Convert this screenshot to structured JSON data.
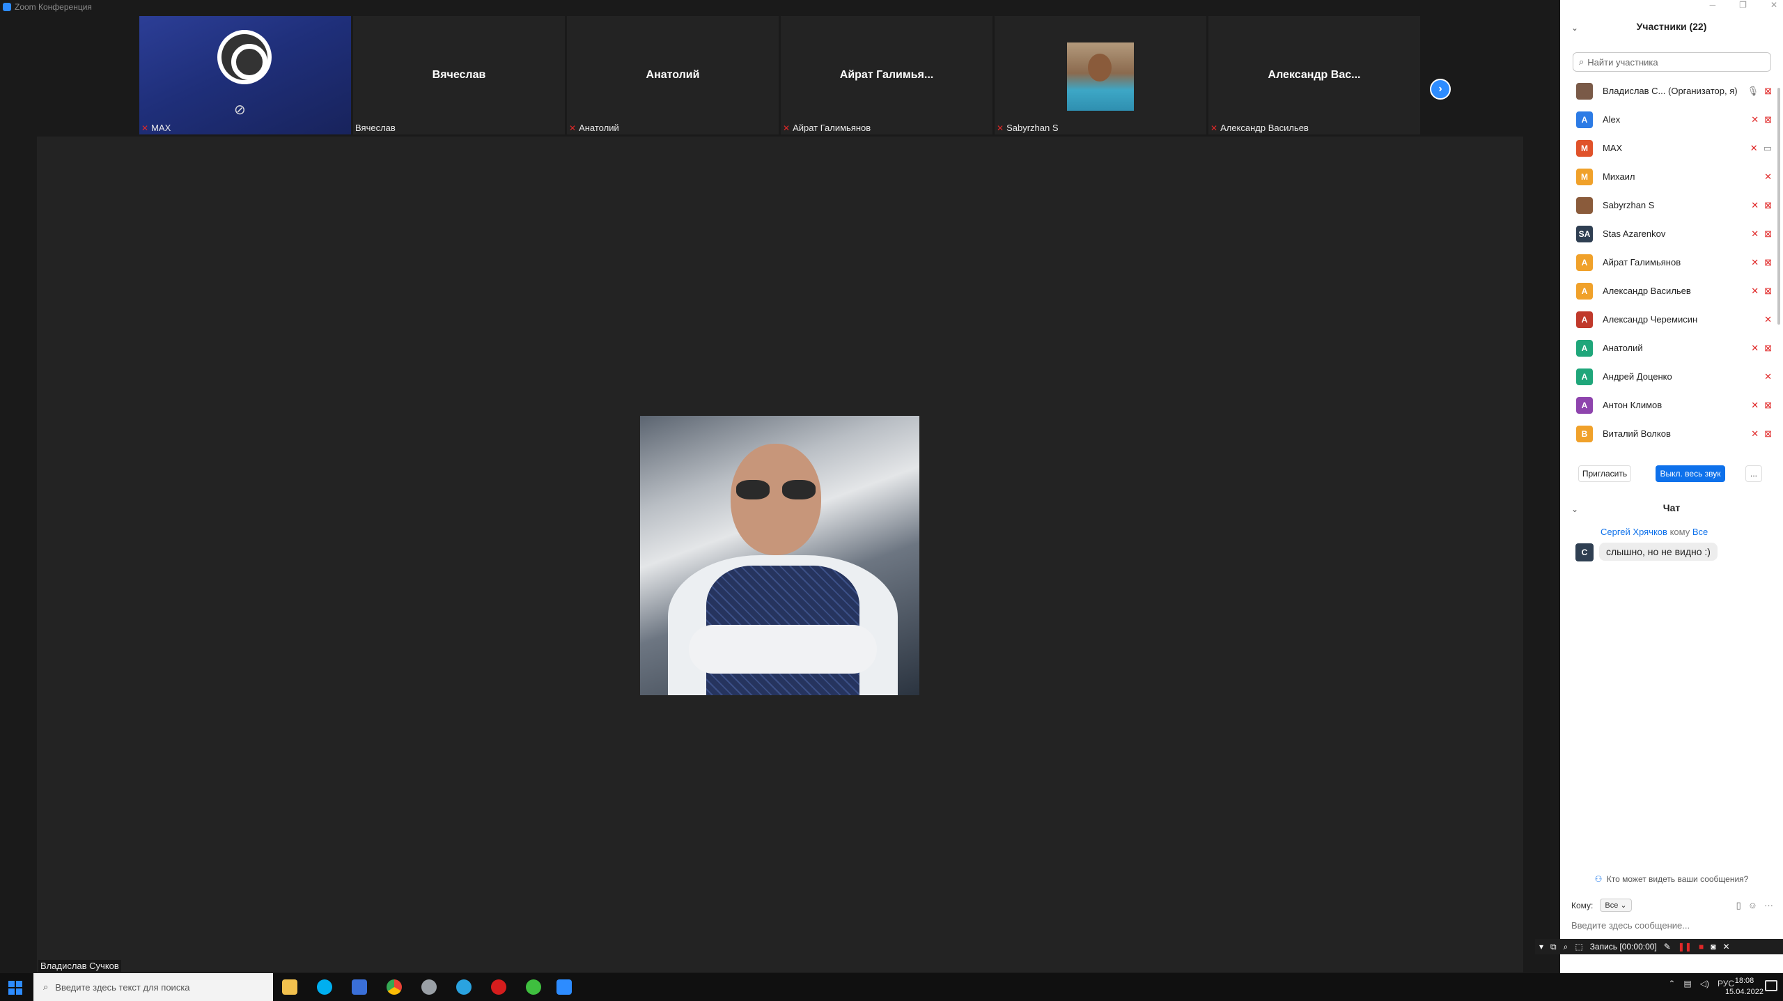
{
  "window": {
    "title": "Zoom Конференция"
  },
  "thumbnails": [
    {
      "name_big": "",
      "label": "MAX",
      "muted": true
    },
    {
      "name_big": "Вячеслав",
      "label": "Вячеслав",
      "muted": false
    },
    {
      "name_big": "Анатолий",
      "label": "Анатолий",
      "muted": true
    },
    {
      "name_big": "Айрат Галимья...",
      "label": "Айрат Галимьянов",
      "muted": true
    },
    {
      "name_big": "",
      "label": "Sabyrzhan S",
      "muted": true
    },
    {
      "name_big": "Александр Вас...",
      "label": "Александр Васильев",
      "muted": true
    }
  ],
  "main": {
    "speaker_name": "Владислав Сучков"
  },
  "participants_panel": {
    "title": "Участники (22)",
    "search_placeholder": "Найти участника",
    "participants": [
      {
        "initial": "",
        "name": "Владислав С... (Организатор, я)",
        "color": "#7a5a48"
      },
      {
        "initial": "A",
        "name": "Alex",
        "color": "#2c7be5"
      },
      {
        "initial": "M",
        "name": "MAX",
        "color": "#e0522a"
      },
      {
        "initial": "M",
        "name": "Михаил",
        "color": "#f0a12a"
      },
      {
        "initial": "",
        "name": "Sabyrzhan S",
        "color": "#8a5b3b"
      },
      {
        "initial": "SA",
        "name": "Stas Azarenkov",
        "color": "#2f3f52"
      },
      {
        "initial": "A",
        "name": "Айрат Галимьянов",
        "color": "#f0a12a"
      },
      {
        "initial": "A",
        "name": "Александр Васильев",
        "color": "#f0a12a"
      },
      {
        "initial": "A",
        "name": "Александр Черемисин",
        "color": "#c0392b"
      },
      {
        "initial": "A",
        "name": "Анатолий",
        "color": "#1fa67a"
      },
      {
        "initial": "A",
        "name": "Андрей Доценко",
        "color": "#1fa67a"
      },
      {
        "initial": "A",
        "name": "Антон Климов",
        "color": "#8e44ad"
      },
      {
        "initial": "B",
        "name": "Виталий Волков",
        "color": "#f0a12a"
      },
      {
        "initial": "",
        "name": "",
        "color": "#1fa67a"
      }
    ],
    "invite_label": "Пригласить",
    "mute_all_label": "Выкл. весь звук",
    "more_label": "..."
  },
  "chat": {
    "title": "Чат",
    "messages": [
      {
        "from": "Сергей Хрячков",
        "mid": "кому",
        "to": "Все",
        "avatar": "С",
        "text": "слышно, но не видно :)"
      }
    ],
    "who_can_see": "Кто может видеть ваши сообщения?",
    "to_label": "Кому:",
    "to_value": "Все",
    "input_placeholder": "Введите здесь сообщение..."
  },
  "recording": {
    "label": "Запись [00:00:00]"
  },
  "taskbar": {
    "search_placeholder": "Введите здесь текст для поиска",
    "lang": "РУС",
    "time": "18:08",
    "date": "15.04.2022"
  }
}
